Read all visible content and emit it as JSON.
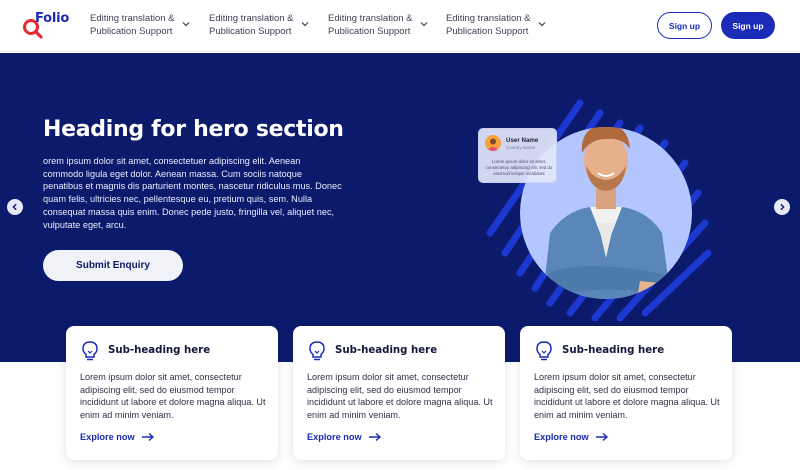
{
  "brand": {
    "name": "Folio",
    "accent": "#1a2bb8",
    "logo_color": "#e32b30"
  },
  "nav": {
    "items": [
      {
        "label": "Editing translation & Publication Support",
        "icon": "chevron-down-icon"
      },
      {
        "label": "Editing translation & Publication Support",
        "icon": "chevron-down-icon"
      },
      {
        "label": "Editing translation & Publication Support",
        "icon": "chevron-down-icon"
      },
      {
        "label": "Editing translation & Publication Support",
        "icon": "chevron-down-icon"
      }
    ],
    "signup_outline_label": "Sign up",
    "signup_solid_label": "Sign up"
  },
  "hero": {
    "title": "Heading for hero section",
    "body": "orem ipsum dolor sit amet, consectetuer adipiscing elit. Aenean commodo ligula eget dolor. Aenean massa. Cum sociis natoque penatibus et magnis dis parturient montes, nascetur ridiculus mus. Donec quam felis, ultricies nec, pellentesque eu, pretium quis, sem. Nulla consequat massa quis enim. Donec pede justo, fringilla vel, aliquet nec, vulputate eget, arcu.",
    "cta_label": "Submit Enquiry",
    "background": "#0c1a6b",
    "prev_icon": "chevron-left-icon",
    "next_icon": "chevron-right-icon",
    "user_card": {
      "name": "User Name",
      "subtitle": "Country Name",
      "text": "Lorem ipsum dolor sit amet, consectetuy adipiscing elit, sed do eiusmod tempor incididunt"
    }
  },
  "cards": [
    {
      "icon": "lightbulb-icon",
      "title": "Sub-heading here",
      "body": "Lorem ipsum dolor sit amet, consectetur adipiscing elit, sed do eiusmod tempor incididunt ut labore et dolore magna aliqua. Ut enim ad minim veniam.",
      "link": "Explore now",
      "link_icon": "arrow-right-icon"
    },
    {
      "icon": "lightbulb-icon",
      "title": "Sub-heading here",
      "body": "Lorem ipsum dolor sit amet, consectetur adipiscing elit, sed do eiusmod tempor incididunt ut labore et dolore magna aliqua. Ut enim ad minim veniam.",
      "link": "Explore now",
      "link_icon": "arrow-right-icon"
    },
    {
      "icon": "lightbulb-icon",
      "title": "Sub-heading here",
      "body": "Lorem ipsum dolor sit amet, consectetur adipiscing elit, sed do eiusmod tempor incididunt ut labore et dolore magna aliqua. Ut enim ad minim veniam.",
      "link": "Explore now",
      "link_icon": "arrow-right-icon"
    }
  ]
}
